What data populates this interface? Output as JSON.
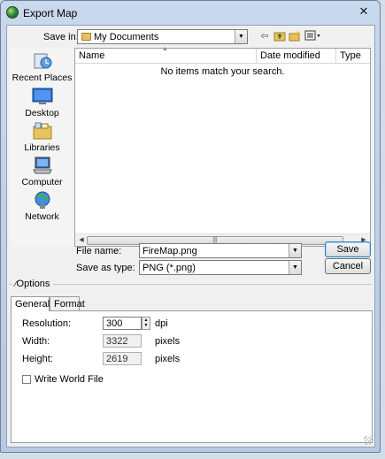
{
  "window": {
    "title": "Export Map",
    "close_glyph": "✕"
  },
  "save_in": {
    "label": "Save in:",
    "value": "My Documents",
    "toolbar_icons": [
      "back-icon",
      "up-folder-icon",
      "new-folder-icon",
      "view-menu-icon"
    ]
  },
  "places": [
    {
      "label": "Recent Places",
      "icon": "recent-places-icon"
    },
    {
      "label": "Desktop",
      "icon": "desktop-icon"
    },
    {
      "label": "Libraries",
      "icon": "libraries-icon"
    },
    {
      "label": "Computer",
      "icon": "computer-icon"
    },
    {
      "label": "Network",
      "icon": "network-icon"
    }
  ],
  "file_list": {
    "columns": [
      "Name",
      "Date modified",
      "Type"
    ],
    "empty_message": "No items match your search."
  },
  "file_name": {
    "label": "File name:",
    "value": "FireMap.png"
  },
  "save_as_type": {
    "label": "Save as type:",
    "value": "PNG (*.png)"
  },
  "buttons": {
    "save": "Save",
    "cancel": "Cancel"
  },
  "options": {
    "label": "Options",
    "tabs": [
      "General",
      "Format"
    ],
    "active_tab": "General",
    "resolution": {
      "label": "Resolution:",
      "value": "300",
      "unit": "dpi"
    },
    "width": {
      "label": "Width:",
      "value": "3322",
      "unit": "pixels"
    },
    "height": {
      "label": "Height:",
      "value": "2619",
      "unit": "pixels"
    },
    "write_world_file": {
      "label": "Write World File",
      "checked": false
    }
  }
}
